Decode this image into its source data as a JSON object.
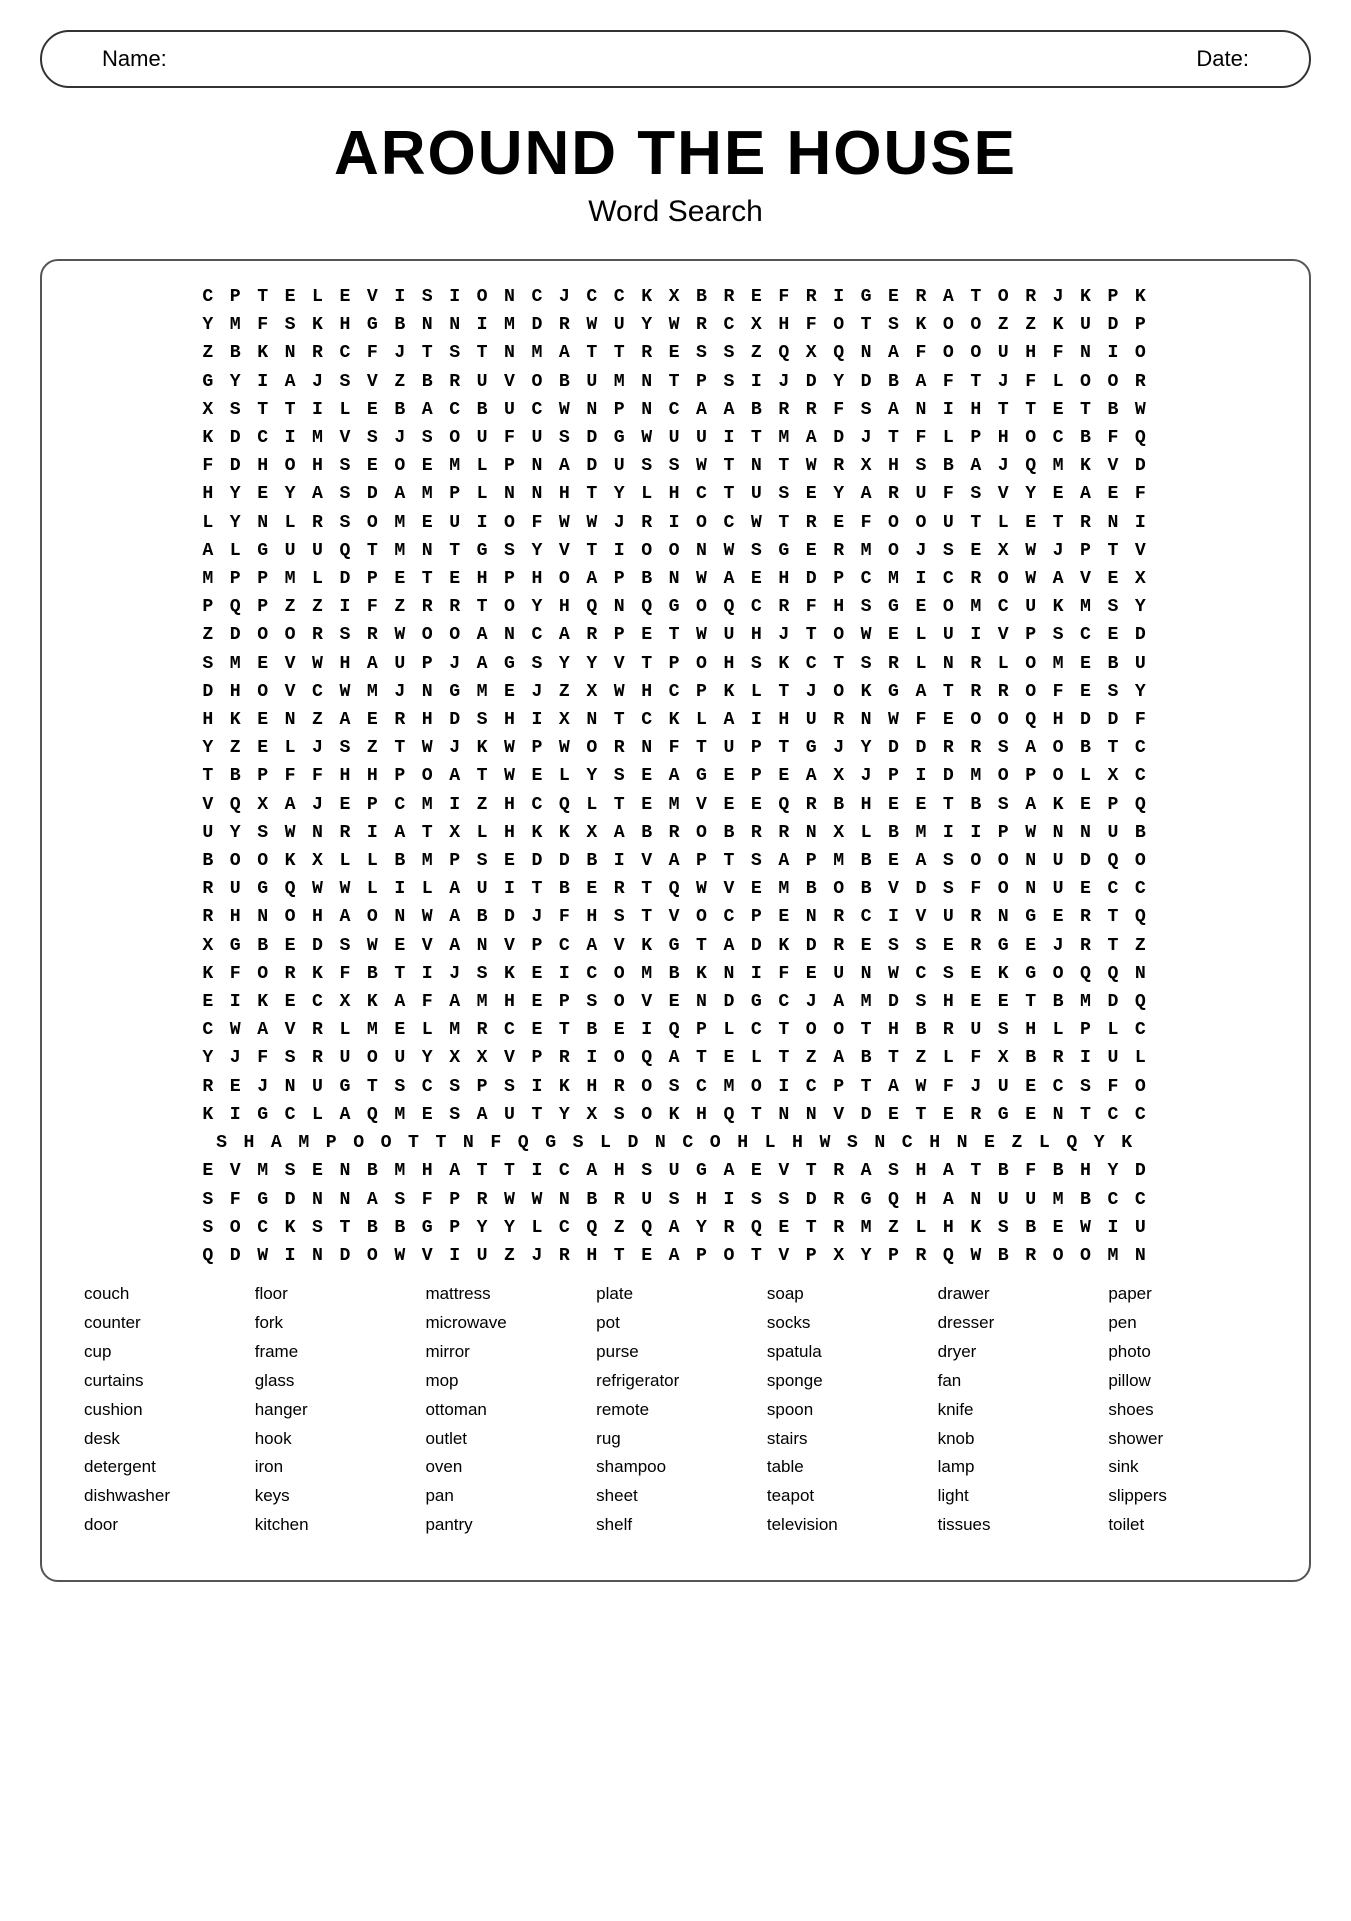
{
  "nameLabel": "Name:",
  "dateLabel": "Date:",
  "mainTitle": "Around The House",
  "subtitle": "Word Search",
  "gridRows": [
    "C P T E L E V I S I O N C J C C K X B R E F R I G E R A T O R J K P K",
    "Y M F S K H G B N N I M D R W U Y W R C X H F O T S K O O Z Z K U D P",
    "Z B K N R C F J T S T N M A T T R E S S Z Q X Q N A F O O U H F N I O",
    "G Y I A J S V Z B R U V O B U M N T P S I J D Y D B A F T J F L O O R",
    "X S T T I L E B A C B U C W N P N C A A B R R F S A N I H T T E T B W",
    "K D C I M V S J S O U F U S D G W U U I T M A D J T F L P H O C B F Q",
    "F D H O H S E O E M L P N A D U S S W T N T W R X H S B A J Q M K V D",
    "H Y E Y A S D A M P L N N H T Y L H C T U S E Y A R U F S V Y E A E F",
    "L Y N L R S O M E U I O F W W J R I O C W T R E F O O U T L E T R N I",
    "A L G U U Q T M N T G S Y V T I O O N W S G E R M O J S E X W J P T V",
    "M P P M L D P E T E H P H O A P B N W A E H D P C M I C R O W A V E X",
    "P Q P Z Z I F Z R R T O Y H Q N Q G O Q C R F H S G E O M C U K M S Y",
    "Z D O O R S R W O O A N C A R P E T W U H J T O W E L U I V P S C E D",
    "S M E V W H A U P J A G S Y Y V T P O H S K C T S R L N R L O M E B U",
    "D H O V C W M J N G M E J Z X W H C P K L T J O K G A T R R O F E S Y",
    "H K E N Z A E R H D S H I X N T C K L A I H U R N W F E O O Q H D D F",
    "Y Z E L J S Z T W J K W P W O R N F T U P T G J Y D D R R S A O B T C",
    "T B P F F H H P O A T W E L Y S E A G E P E A X J P I D M O P O L X C",
    "V Q X A J E P C M I Z H C Q L T E M V E E Q R B H E E T B S A K E P Q",
    "U Y S W N R I A T X L H K K X A B R O B R R N X L B M I I P W N N U B",
    "B O O K X L L B M P S E D D B I V A P T S A P M B E A S O O N U D Q O",
    "R U G Q W W L I L A U I T B E R T Q W V E M B O B V D S F O N U E C C",
    "R H N O H A O N W A B D J F H S T V O C P E N R C I V U R N G E R T Q",
    "X G B E D S W E V A N V P C A V K G T A D K D R E S S E R G E J R T Z",
    "K F O R K F B T I J S K E I C O M B K N I F E U N W C S E K G O Q Q N",
    "E I K E C X K A F A M H E P S O V E N D G C J A M D S H E E T B M D Q",
    "C W A V R L M E L M R C E T B E I Q P L C T O O T H B R U S H L P L C",
    "Y J F S R U O U Y X X V P R I O Q A T E L T Z A B T Z L F X B R I U L",
    "R E J N U G T S C S P S I K H R O S C M O I C P T A W F J U E C S F O",
    "K I G C L A Q M E S A U T Y X S O K H Q T N N V D E T E R G E N T C C",
    "S H A M P O O T T N F Q G S L D N C O H L H W S N C H N E Z L Q Y K",
    "E V M S E N B M H A T T I C A H S U G A E V T R A S H A T B F B H Y D",
    "S F G D N N A S F P R W W N B R U S H I S S D R G Q H A N U U M B C C",
    "S O C K S T B B G P Y Y L C Q Z Q A Y R Q E T R M Z L H K S B E W I U",
    "Q D W I N D O W V I U Z J R H T E A P O T V P X Y P R Q W B R O O M N"
  ],
  "wordColumns": [
    [
      "couch",
      "counter",
      "cup",
      "curtains",
      "cushion",
      "desk",
      "detergent",
      "dishwasher",
      "door"
    ],
    [
      "floor",
      "fork",
      "frame",
      "glass",
      "hanger",
      "hook",
      "iron",
      "keys",
      "kitchen"
    ],
    [
      "mattress",
      "microwave",
      "mirror",
      "mop",
      "ottoman",
      "outlet",
      "oven",
      "pan",
      "pantry"
    ],
    [
      "plate",
      "pot",
      "purse",
      "refrigerator",
      "remote",
      "rug",
      "shampoo",
      "sheet",
      "shelf"
    ],
    [
      "soap",
      "socks",
      "spatula",
      "sponge",
      "spoon",
      "stairs",
      "table",
      "teapot",
      "television"
    ],
    [
      "drawer",
      "dresser",
      "dryer",
      "fan",
      "knife",
      "knob",
      "lamp",
      "light",
      "tissues"
    ],
    [
      "paper",
      "pen",
      "photo",
      "pillow",
      "shoes",
      "shower",
      "sink",
      "slippers",
      "toilet"
    ]
  ]
}
